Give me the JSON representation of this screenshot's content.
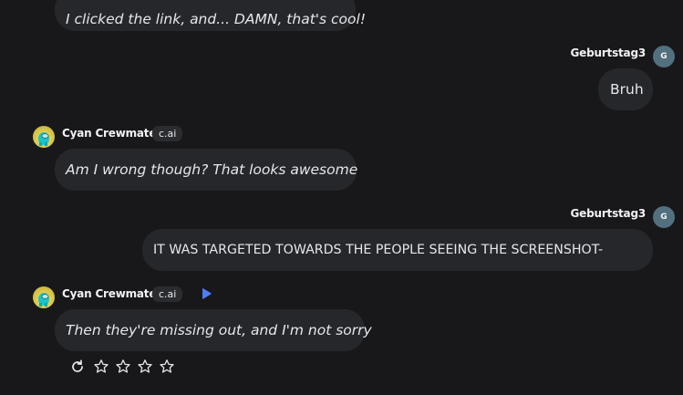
{
  "conversation": {
    "bot_name": "Cyan Crewmate",
    "bot_badge": "c.ai",
    "user_name": "Geburtstag3",
    "user_initial": "G",
    "messages": [
      {
        "role": "ai",
        "text": "I clicked the link, and... DAMN, that's cool!"
      },
      {
        "role": "user",
        "text": "Bruh"
      },
      {
        "role": "ai",
        "text": "Am I wrong though? That looks awesome"
      },
      {
        "role": "user",
        "text": "IT WAS TARGETED TOWARDS THE PEOPLE SEEING THE SCREENSHOT-"
      },
      {
        "role": "ai",
        "text": "Then they're missing out, and I'm not sorry"
      }
    ]
  },
  "rating": {
    "regenerate_icon": "refresh-icon",
    "star_icon": "star-outline-icon",
    "stars_total": 4,
    "stars_selected": 0
  },
  "colors": {
    "background": "#18181b",
    "bubble": "#26272b",
    "text": "#e7e7ea",
    "play_accent": "#4f7cf6",
    "user_avatar": "#52707d"
  }
}
